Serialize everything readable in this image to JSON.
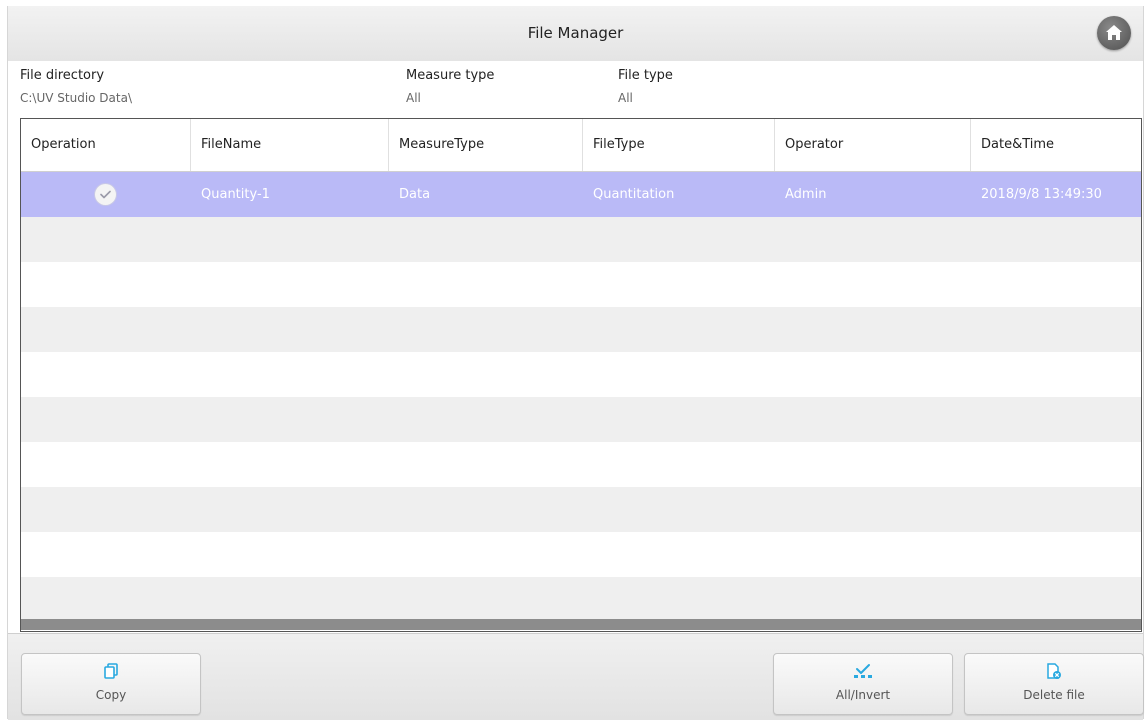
{
  "window": {
    "title": "File Manager"
  },
  "filters": {
    "directory": {
      "label": "File directory",
      "value": "C:\\UV Studio Data\\"
    },
    "measure_type": {
      "label": "Measure type",
      "value": "All"
    },
    "file_type": {
      "label": "File type",
      "value": "All"
    }
  },
  "table": {
    "columns": [
      "Operation",
      "FileName",
      "MeasureType",
      "FileType",
      "Operator",
      "Date&Time"
    ],
    "rows": [
      {
        "selected": true,
        "checked": true,
        "filename": "Quantity-1",
        "measure_type": "Data",
        "file_type": "Quantitation",
        "operator": "Admin",
        "datetime": "2018/9/8 13:49:30"
      }
    ],
    "empty_row_count": 9
  },
  "buttons": {
    "copy": "Copy",
    "all_invert": "All/Invert",
    "delete_file": "Delete file"
  },
  "colors": {
    "selected_row": "#babaf7",
    "alt_row": "#efefef",
    "icon_accent": "#29a9e0"
  },
  "icons": {
    "home": "home-icon",
    "check": "check-icon",
    "copy": "copy-icon",
    "all_invert": "select-all-icon",
    "delete_file": "delete-file-icon"
  }
}
